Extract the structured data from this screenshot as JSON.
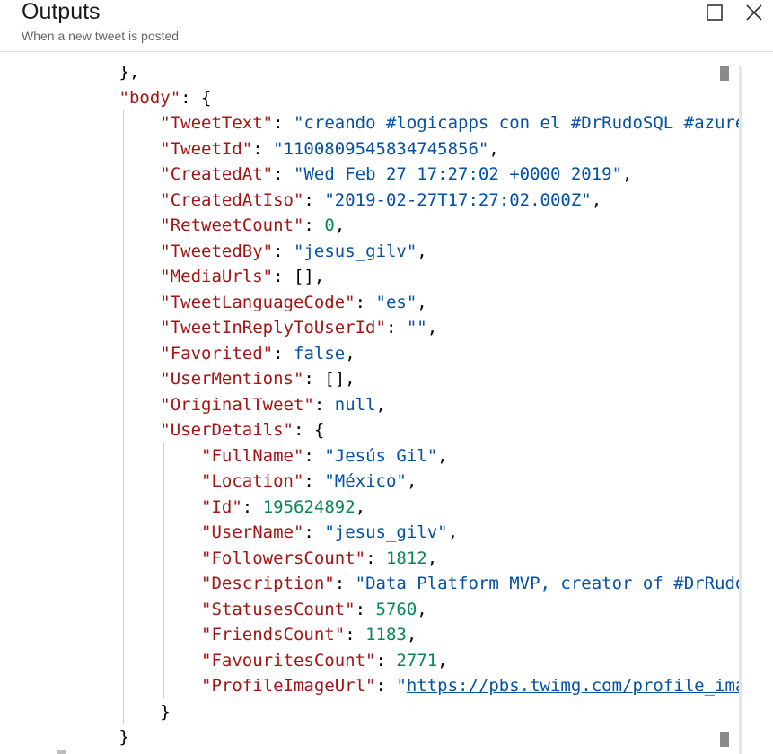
{
  "header": {
    "title": "Outputs",
    "subtitle": "When a new tweet is posted"
  },
  "icons": {
    "maximize": "square-maximize-icon",
    "close": "x-close-icon"
  },
  "colors": {
    "key": "#a31515",
    "string": "#0451a5",
    "number": "#098658",
    "keyword": "#0451a5"
  },
  "json_lines": [
    {
      "indent": 2,
      "parts": [
        {
          "t": "p",
          "v": "},"
        }
      ]
    },
    {
      "indent": 2,
      "parts": [
        {
          "t": "k",
          "v": "\"body\""
        },
        {
          "t": "p",
          "v": ": {"
        }
      ]
    },
    {
      "indent": 3,
      "parts": [
        {
          "t": "k",
          "v": "\"TweetText\""
        },
        {
          "t": "p",
          "v": ": "
        },
        {
          "t": "s",
          "v": "\"creando #logicapps con el #DrRudoSQL #azure\""
        }
      ]
    },
    {
      "indent": 3,
      "parts": [
        {
          "t": "k",
          "v": "\"TweetId\""
        },
        {
          "t": "p",
          "v": ": "
        },
        {
          "t": "s",
          "v": "\"1100809545834745856\""
        },
        {
          "t": "p",
          "v": ","
        }
      ]
    },
    {
      "indent": 3,
      "parts": [
        {
          "t": "k",
          "v": "\"CreatedAt\""
        },
        {
          "t": "p",
          "v": ": "
        },
        {
          "t": "s",
          "v": "\"Wed Feb 27 17:27:02 +0000 2019\""
        },
        {
          "t": "p",
          "v": ","
        }
      ]
    },
    {
      "indent": 3,
      "parts": [
        {
          "t": "k",
          "v": "\"CreatedAtIso\""
        },
        {
          "t": "p",
          "v": ": "
        },
        {
          "t": "s",
          "v": "\"2019-02-27T17:27:02.000Z\""
        },
        {
          "t": "p",
          "v": ","
        }
      ]
    },
    {
      "indent": 3,
      "parts": [
        {
          "t": "k",
          "v": "\"RetweetCount\""
        },
        {
          "t": "p",
          "v": ": "
        },
        {
          "t": "n",
          "v": "0"
        },
        {
          "t": "p",
          "v": ","
        }
      ]
    },
    {
      "indent": 3,
      "parts": [
        {
          "t": "k",
          "v": "\"TweetedBy\""
        },
        {
          "t": "p",
          "v": ": "
        },
        {
          "t": "s",
          "v": "\"jesus_gilv\""
        },
        {
          "t": "p",
          "v": ","
        }
      ]
    },
    {
      "indent": 3,
      "parts": [
        {
          "t": "k",
          "v": "\"MediaUrls\""
        },
        {
          "t": "p",
          "v": ": [],"
        }
      ]
    },
    {
      "indent": 3,
      "parts": [
        {
          "t": "k",
          "v": "\"TweetLanguageCode\""
        },
        {
          "t": "p",
          "v": ": "
        },
        {
          "t": "s",
          "v": "\"es\""
        },
        {
          "t": "p",
          "v": ","
        }
      ]
    },
    {
      "indent": 3,
      "parts": [
        {
          "t": "k",
          "v": "\"TweetInReplyToUserId\""
        },
        {
          "t": "p",
          "v": ": "
        },
        {
          "t": "s",
          "v": "\"\""
        },
        {
          "t": "p",
          "v": ","
        }
      ]
    },
    {
      "indent": 3,
      "parts": [
        {
          "t": "k",
          "v": "\"Favorited\""
        },
        {
          "t": "p",
          "v": ": "
        },
        {
          "t": "b",
          "v": "false"
        },
        {
          "t": "p",
          "v": ","
        }
      ]
    },
    {
      "indent": 3,
      "parts": [
        {
          "t": "k",
          "v": "\"UserMentions\""
        },
        {
          "t": "p",
          "v": ": [],"
        }
      ]
    },
    {
      "indent": 3,
      "parts": [
        {
          "t": "k",
          "v": "\"OriginalTweet\""
        },
        {
          "t": "p",
          "v": ": "
        },
        {
          "t": "b",
          "v": "null"
        },
        {
          "t": "p",
          "v": ","
        }
      ]
    },
    {
      "indent": 3,
      "parts": [
        {
          "t": "k",
          "v": "\"UserDetails\""
        },
        {
          "t": "p",
          "v": ": {"
        }
      ]
    },
    {
      "indent": 4,
      "parts": [
        {
          "t": "k",
          "v": "\"FullName\""
        },
        {
          "t": "p",
          "v": ": "
        },
        {
          "t": "s",
          "v": "\"Jesús Gil\""
        },
        {
          "t": "p",
          "v": ","
        }
      ]
    },
    {
      "indent": 4,
      "parts": [
        {
          "t": "k",
          "v": "\"Location\""
        },
        {
          "t": "p",
          "v": ": "
        },
        {
          "t": "s",
          "v": "\"México\""
        },
        {
          "t": "p",
          "v": ","
        }
      ]
    },
    {
      "indent": 4,
      "parts": [
        {
          "t": "k",
          "v": "\"Id\""
        },
        {
          "t": "p",
          "v": ": "
        },
        {
          "t": "n",
          "v": "195624892"
        },
        {
          "t": "p",
          "v": ","
        }
      ]
    },
    {
      "indent": 4,
      "parts": [
        {
          "t": "k",
          "v": "\"UserName\""
        },
        {
          "t": "p",
          "v": ": "
        },
        {
          "t": "s",
          "v": "\"jesus_gilv\""
        },
        {
          "t": "p",
          "v": ","
        }
      ]
    },
    {
      "indent": 4,
      "parts": [
        {
          "t": "k",
          "v": "\"FollowersCount\""
        },
        {
          "t": "p",
          "v": ": "
        },
        {
          "t": "n",
          "v": "1812"
        },
        {
          "t": "p",
          "v": ","
        }
      ]
    },
    {
      "indent": 4,
      "parts": [
        {
          "t": "k",
          "v": "\"Description\""
        },
        {
          "t": "p",
          "v": ": "
        },
        {
          "t": "s",
          "v": "\"Data Platform MVP, creator of #DrRudoS"
        }
      ]
    },
    {
      "indent": 4,
      "parts": [
        {
          "t": "k",
          "v": "\"StatusesCount\""
        },
        {
          "t": "p",
          "v": ": "
        },
        {
          "t": "n",
          "v": "5760"
        },
        {
          "t": "p",
          "v": ","
        }
      ]
    },
    {
      "indent": 4,
      "parts": [
        {
          "t": "k",
          "v": "\"FriendsCount\""
        },
        {
          "t": "p",
          "v": ": "
        },
        {
          "t": "n",
          "v": "1183"
        },
        {
          "t": "p",
          "v": ","
        }
      ]
    },
    {
      "indent": 4,
      "parts": [
        {
          "t": "k",
          "v": "\"FavouritesCount\""
        },
        {
          "t": "p",
          "v": ": "
        },
        {
          "t": "n",
          "v": "2771"
        },
        {
          "t": "p",
          "v": ","
        }
      ]
    },
    {
      "indent": 4,
      "parts": [
        {
          "t": "k",
          "v": "\"ProfileImageUrl\""
        },
        {
          "t": "p",
          "v": ": "
        },
        {
          "t": "s",
          "v": "\""
        },
        {
          "t": "u",
          "v": "https://pbs.twimg.com/profile_imag"
        }
      ]
    },
    {
      "indent": 3,
      "parts": [
        {
          "t": "p",
          "v": "}"
        }
      ]
    },
    {
      "indent": 2,
      "parts": [
        {
          "t": "p",
          "v": "}"
        }
      ]
    }
  ]
}
